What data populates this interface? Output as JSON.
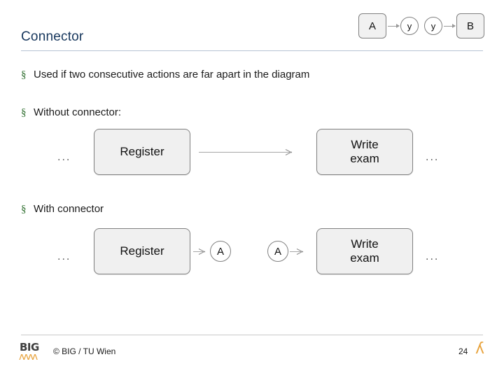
{
  "slide": {
    "title": "Connector",
    "page_number": "24",
    "footer": "© BIG / TU Wien"
  },
  "header_diagram": {
    "box_a": "A",
    "circle_y_left": "y",
    "circle_y_right": "y",
    "box_b": "B"
  },
  "bullets": [
    {
      "marker": "§",
      "text": "Used if two consecutive actions are far apart in the diagram"
    },
    {
      "marker": "§",
      "text": "Without connector:"
    },
    {
      "marker": "§",
      "text": "With connector"
    }
  ],
  "flow_without_connector": {
    "left_ellipsis": "...",
    "node_1": "Register",
    "node_2": "Write\nexam",
    "node_2_line1": "Write",
    "node_2_line2": "exam",
    "right_ellipsis": "..."
  },
  "flow_with_connector": {
    "left_ellipsis": "...",
    "node_1": "Register",
    "connector_out": "A",
    "connector_in": "A",
    "node_2_line1": "Write",
    "node_2_line2": "exam",
    "right_ellipsis": "..."
  },
  "logo": {
    "big_text": "BIG",
    "figures": "ʌʌʌʌ",
    "right_mark": "ʎ"
  },
  "colors": {
    "title": "#16365c",
    "bullet_marker": "#2f6f2f",
    "node_fill": "#f0f0f0",
    "node_border": "#808080",
    "accent_orange": "#e8a33d"
  }
}
